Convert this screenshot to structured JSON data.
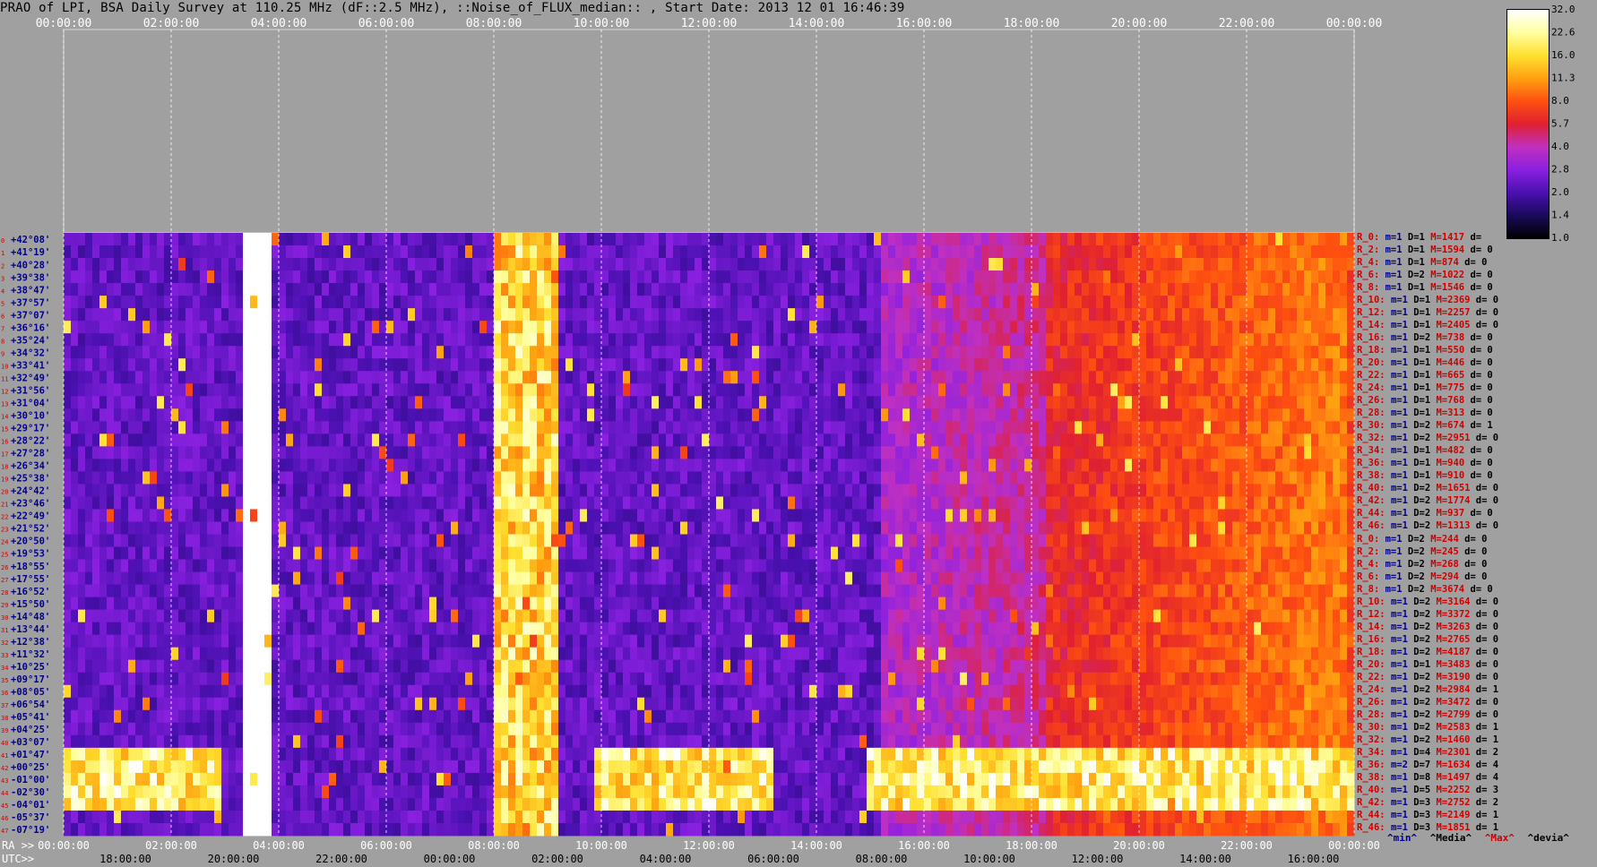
{
  "title": "PRAO of LPI, BSA Daily Survey at 110.25 MHz (dF::2.5 MHz), ::Noise_of_FLUX_median:: , Start Date: 2013 12 01 16:46:39",
  "chart_data": {
    "type": "heatmap",
    "title": "PRAO of LPI, BSA Daily Survey at 110.25 MHz (dF::2.5 MHz), ::Noise_of_FLUX_median:: , Start Date: 2013 12 01 16:46:39",
    "top_axis_ticks": [
      "00:00:00",
      "02:00:00",
      "04:00:00",
      "06:00:00",
      "08:00:00",
      "10:00:00",
      "12:00:00",
      "14:00:00",
      "16:00:00",
      "18:00:00",
      "20:00:00",
      "22:00:00",
      "00:00:00"
    ],
    "bottom_ra_label": "RA >>",
    "bottom_ra_ticks": [
      "00:00:00",
      "02:00:00",
      "04:00:00",
      "06:00:00",
      "08:00:00",
      "10:00:00",
      "12:00:00",
      "14:00:00",
      "16:00:00",
      "18:00:00",
      "20:00:00",
      "22:00:00",
      "00:00:00"
    ],
    "bottom_utc_label": "UTC>>",
    "bottom_utc_ticks": [
      "18:00:00",
      "20:00:00",
      "22:00:00",
      "00:00:00",
      "02:00:00",
      "04:00:00",
      "06:00:00",
      "08:00:00",
      "10:00:00",
      "12:00:00",
      "14:00:00",
      "16:00:00"
    ],
    "declinations": [
      "+42°08'",
      "+41°19'",
      "+40°28'",
      "+39°38'",
      "+38°47'",
      "+37°57'",
      "+37°07'",
      "+36°16'",
      "+35°24'",
      "+34°32'",
      "+33°41'",
      "+32°49'",
      "+31°56'",
      "+31°04'",
      "+30°10'",
      "+29°17'",
      "+28°22'",
      "+27°28'",
      "+26°34'",
      "+25°38'",
      "+24°42'",
      "+23°46'",
      "+22°49'",
      "+21°52'",
      "+20°50'",
      "+19°53'",
      "+18°55'",
      "+17°55'",
      "+16°52'",
      "+15°50'",
      "+14°48'",
      "+13°44'",
      "+12°38'",
      "+11°32'",
      "+10°25'",
      "+09°17'",
      "+08°05'",
      "+06°54'",
      "+05°41'",
      "+04°25'",
      "+03°07'",
      "+01°47'",
      "+00°25'",
      "-01°00'",
      "-02°30'",
      "-04°01'",
      "-05°37'",
      "-07°19'"
    ],
    "colorbar_ticks": [
      "32.0",
      "22.6",
      "16.0",
      "11.3",
      "8.0",
      "5.7",
      "4.0",
      "2.8",
      "2.0",
      "1.4",
      "1.0"
    ],
    "colorbar_range": [
      1.0,
      32.0
    ],
    "colorbar_scale": "log",
    "colormap": [
      "#000000",
      "#1a0a5a",
      "#4a10b0",
      "#8a20e0",
      "#c030c0",
      "#e02030",
      "#ff5010",
      "#ffa010",
      "#ffe030",
      "#ffffa0",
      "#ffffff"
    ]
  },
  "side_table": [
    {
      "r": "R_0:",
      "m": "m=1",
      "d": "D=1",
      "mx": "M=1417",
      "dev": "d="
    },
    {
      "r": "R_2:",
      "m": "m=1",
      "d": "D=1",
      "mx": "M=1594",
      "dev": "d= 0"
    },
    {
      "r": "R_4:",
      "m": "m=1",
      "d": "D=1",
      "mx": "M=874",
      "dev": "d= 0"
    },
    {
      "r": "R_6:",
      "m": "m=1",
      "d": "D=2",
      "mx": "M=1022",
      "dev": "d= 0"
    },
    {
      "r": "R_8:",
      "m": "m=1",
      "d": "D=1",
      "mx": "M=1546",
      "dev": "d= 0"
    },
    {
      "r": "R_10:",
      "m": "m=1",
      "d": "D=1",
      "mx": "M=2369",
      "dev": "d= 0"
    },
    {
      "r": "R_12:",
      "m": "m=1",
      "d": "D=1",
      "mx": "M=2257",
      "dev": "d= 0"
    },
    {
      "r": "R_14:",
      "m": "m=1",
      "d": "D=1",
      "mx": "M=2405",
      "dev": "d= 0"
    },
    {
      "r": "R_16:",
      "m": "m=1",
      "d": "D=2",
      "mx": "M=738",
      "dev": "d= 0"
    },
    {
      "r": "R_18:",
      "m": "m=1",
      "d": "D=1",
      "mx": "M=550",
      "dev": "d= 0"
    },
    {
      "r": "R_20:",
      "m": "m=1",
      "d": "D=1",
      "mx": "M=446",
      "dev": "d= 0"
    },
    {
      "r": "R_22:",
      "m": "m=1",
      "d": "D=1",
      "mx": "M=665",
      "dev": "d= 0"
    },
    {
      "r": "R_24:",
      "m": "m=1",
      "d": "D=1",
      "mx": "M=775",
      "dev": "d= 0"
    },
    {
      "r": "R_26:",
      "m": "m=1",
      "d": "D=1",
      "mx": "M=768",
      "dev": "d= 0"
    },
    {
      "r": "R_28:",
      "m": "m=1",
      "d": "D=1",
      "mx": "M=313",
      "dev": "d= 0"
    },
    {
      "r": "R_30:",
      "m": "m=1",
      "d": "D=2",
      "mx": "M=674",
      "dev": "d= 1"
    },
    {
      "r": "R_32:",
      "m": "m=1",
      "d": "D=2",
      "mx": "M=2951",
      "dev": "d= 0"
    },
    {
      "r": "R_34:",
      "m": "m=1",
      "d": "D=1",
      "mx": "M=482",
      "dev": "d= 0"
    },
    {
      "r": "R_36:",
      "m": "m=1",
      "d": "D=1",
      "mx": "M=940",
      "dev": "d= 0"
    },
    {
      "r": "R_38:",
      "m": "m=1",
      "d": "D=1",
      "mx": "M=910",
      "dev": "d= 0"
    },
    {
      "r": "R_40:",
      "m": "m=1",
      "d": "D=2",
      "mx": "M=1651",
      "dev": "d= 0"
    },
    {
      "r": "R_42:",
      "m": "m=1",
      "d": "D=2",
      "mx": "M=1774",
      "dev": "d= 0"
    },
    {
      "r": "R_44:",
      "m": "m=1",
      "d": "D=2",
      "mx": "M=937",
      "dev": "d= 0"
    },
    {
      "r": "R_46:",
      "m": "m=1",
      "d": "D=2",
      "mx": "M=1313",
      "dev": "d= 0"
    },
    {
      "r": "R_0:",
      "m": "m=1",
      "d": "D=2",
      "mx": "M=244",
      "dev": "d= 0"
    },
    {
      "r": "R_2:",
      "m": "m=1",
      "d": "D=2",
      "mx": "M=245",
      "dev": "d= 0"
    },
    {
      "r": "R_4:",
      "m": "m=1",
      "d": "D=2",
      "mx": "M=268",
      "dev": "d= 0"
    },
    {
      "r": "R_6:",
      "m": "m=1",
      "d": "D=2",
      "mx": "M=294",
      "dev": "d= 0"
    },
    {
      "r": "R_8:",
      "m": "m=1",
      "d": "D=2",
      "mx": "M=3674",
      "dev": "d= 0"
    },
    {
      "r": "R_10:",
      "m": "m=1",
      "d": "D=2",
      "mx": "M=3164",
      "dev": "d= 0"
    },
    {
      "r": "R_12:",
      "m": "m=1",
      "d": "D=2",
      "mx": "M=3372",
      "dev": "d= 0"
    },
    {
      "r": "R_14:",
      "m": "m=1",
      "d": "D=2",
      "mx": "M=3263",
      "dev": "d= 0"
    },
    {
      "r": "R_16:",
      "m": "m=1",
      "d": "D=2",
      "mx": "M=2765",
      "dev": "d= 0"
    },
    {
      "r": "R_18:",
      "m": "m=1",
      "d": "D=2",
      "mx": "M=4187",
      "dev": "d= 0"
    },
    {
      "r": "R_20:",
      "m": "m=1",
      "d": "D=1",
      "mx": "M=3483",
      "dev": "d= 0"
    },
    {
      "r": "R_22:",
      "m": "m=1",
      "d": "D=2",
      "mx": "M=3190",
      "dev": "d= 0"
    },
    {
      "r": "R_24:",
      "m": "m=1",
      "d": "D=2",
      "mx": "M=2984",
      "dev": "d= 1"
    },
    {
      "r": "R_26:",
      "m": "m=1",
      "d": "D=2",
      "mx": "M=3472",
      "dev": "d= 0"
    },
    {
      "r": "R_28:",
      "m": "m=1",
      "d": "D=2",
      "mx": "M=2799",
      "dev": "d= 0"
    },
    {
      "r": "R_30:",
      "m": "m=1",
      "d": "D=2",
      "mx": "M=2583",
      "dev": "d= 1"
    },
    {
      "r": "R_32:",
      "m": "m=1",
      "d": "D=2",
      "mx": "M=1460",
      "dev": "d= 1"
    },
    {
      "r": "R_34:",
      "m": "m=1",
      "d": "D=4",
      "mx": "M=2301",
      "dev": "d= 2"
    },
    {
      "r": "R_36:",
      "m": "m=2",
      "d": "D=7",
      "mx": "M=1634",
      "dev": "d= 4"
    },
    {
      "r": "R_38:",
      "m": "m=1",
      "d": "D=8",
      "mx": "M=1497",
      "dev": "d= 4"
    },
    {
      "r": "R_40:",
      "m": "m=1",
      "d": "D=5",
      "mx": "M=2252",
      "dev": "d= 3"
    },
    {
      "r": "R_42:",
      "m": "m=1",
      "d": "D=3",
      "mx": "M=2752",
      "dev": "d= 2"
    },
    {
      "r": "R_44:",
      "m": "m=1",
      "d": "D=3",
      "mx": "M=2149",
      "dev": "d= 1"
    },
    {
      "r": "R_46:",
      "m": "m=1",
      "d": "D=3",
      "mx": "M=1851",
      "dev": "d= 1"
    }
  ],
  "bottom_legend": {
    "min": "^min^",
    "median": "^Media^",
    "max": "^Max^",
    "dev": "^devia^"
  },
  "row_index_labels": [
    "0",
    "1",
    "2",
    "3",
    "4",
    "5",
    "6",
    "7",
    "8",
    "9",
    "10",
    "11",
    "12",
    "13",
    "14",
    "15",
    "16",
    "17",
    "18",
    "19",
    "20",
    "21",
    "22",
    "23",
    "24",
    "25",
    "26",
    "27",
    "28",
    "29",
    "30",
    "31",
    "32",
    "33",
    "34",
    "35",
    "36",
    "37",
    "38",
    "39",
    "40",
    "41",
    "42",
    "43",
    "44",
    "45",
    "46",
    "47"
  ]
}
